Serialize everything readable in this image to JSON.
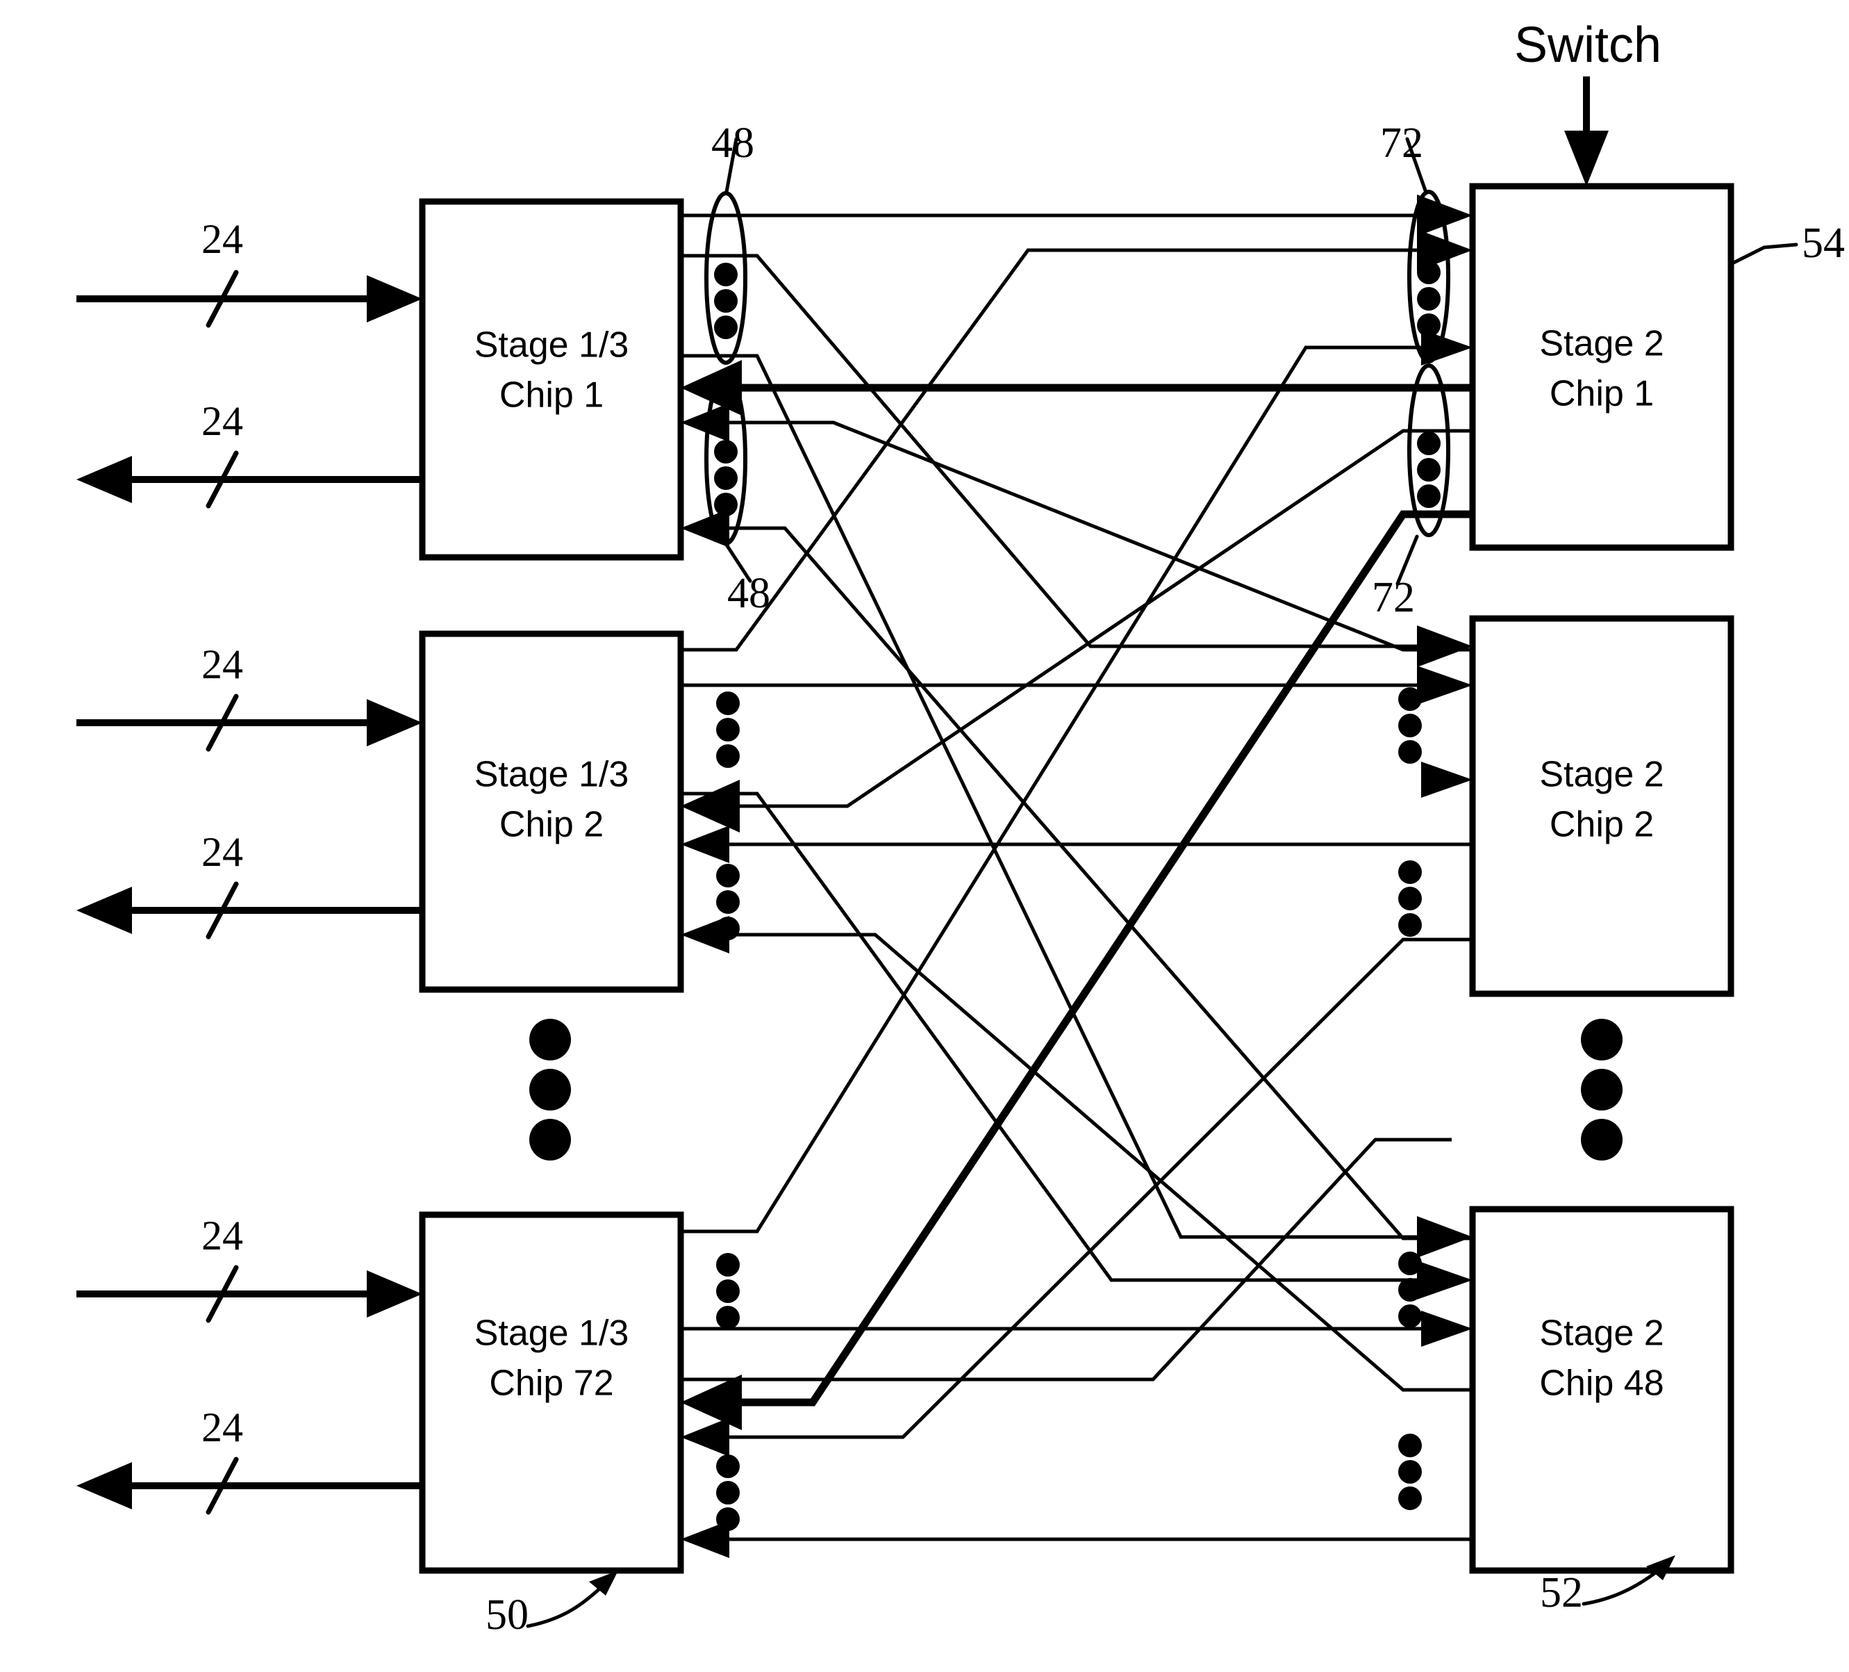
{
  "figure": {
    "title": "Switch",
    "switch_label": "Switch",
    "reference_numbers": {
      "switch_overall": "54",
      "left_column_group": "50",
      "right_column_group": "52",
      "left_link_bundle_top": "48",
      "left_link_bundle_bottom": "48",
      "right_link_bundle_top": "72",
      "right_link_bundle_bottom": "72"
    },
    "left_boxes": [
      {
        "line1": "Stage 1/3",
        "line2": "Chip 1"
      },
      {
        "line1": "Stage 1/3",
        "line2": "Chip 2"
      },
      {
        "line1": "Stage 1/3",
        "line2": "Chip 72"
      }
    ],
    "right_boxes": [
      {
        "line1": "Stage 2",
        "line2": "Chip 1"
      },
      {
        "line1": "Stage 2",
        "line2": "Chip 2"
      },
      {
        "line1": "Stage 2",
        "line2": "Chip 48"
      }
    ],
    "io_buses": [
      {
        "row": 1,
        "direction": "in",
        "width_label": "24"
      },
      {
        "row": 1,
        "direction": "out",
        "width_label": "24"
      },
      {
        "row": 2,
        "direction": "in",
        "width_label": "24"
      },
      {
        "row": 2,
        "direction": "out",
        "width_label": "24"
      },
      {
        "row": 3,
        "direction": "in",
        "width_label": "24"
      },
      {
        "row": 3,
        "direction": "out",
        "width_label": "24"
      }
    ],
    "vertical_ellipsis_left": "⋮",
    "vertical_ellipsis_right": "⋮"
  }
}
